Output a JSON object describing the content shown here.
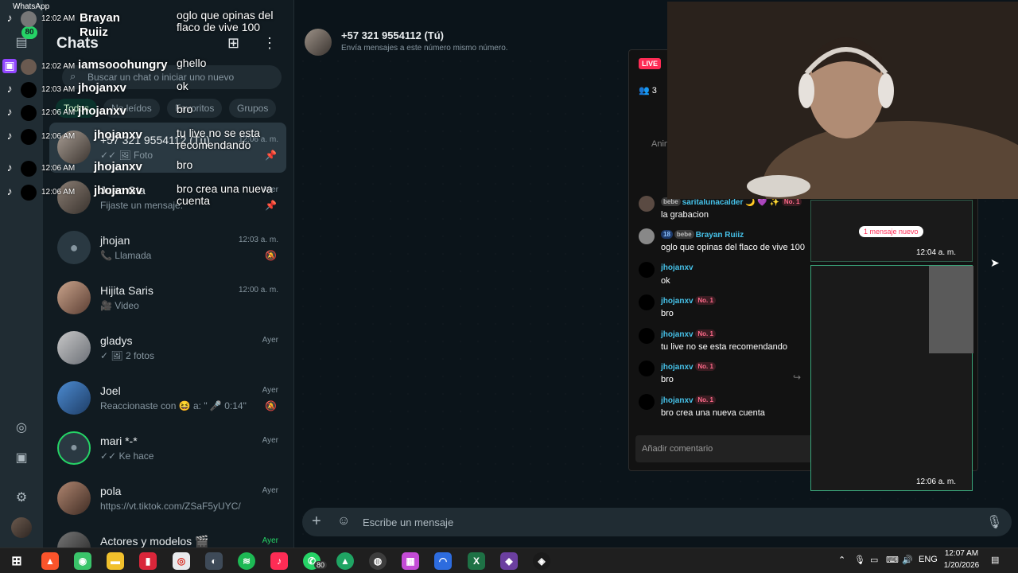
{
  "window": {
    "app_name": "WhatsApp"
  },
  "rail": {
    "badge": "80"
  },
  "panel": {
    "title": "Chats",
    "search_placeholder": "Buscar un chat o iniciar uno nuevo",
    "filters": [
      "Todos",
      "No leídos",
      "Favoritos",
      "Grupos"
    ]
  },
  "chats": [
    {
      "name": "+57 321 9554112 (Tú)",
      "time": "12:06 a. m.",
      "preview": "✓✓ 🖼 Foto"
    },
    {
      "name": "Juan Gta",
      "time": "Ayer",
      "preview": "Fijaste un mensaje."
    },
    {
      "name": "jhojan",
      "time": "12:03 a. m.",
      "preview": "📞 Llamada"
    },
    {
      "name": "Hijita Saris",
      "time": "12:00 a. m.",
      "preview": "🎥 Video"
    },
    {
      "name": "gladys",
      "time": "Ayer",
      "preview": "✓ 🖼 2 fotos"
    },
    {
      "name": "Joel",
      "time": "Ayer",
      "preview": "Reaccionaste con 😆 a: \" 🎤 0:14\""
    },
    {
      "name": "mari *-*",
      "time": "Ayer",
      "preview": "✓✓ Ke hace"
    },
    {
      "name": "pola",
      "time": "Ayer",
      "preview": "https://vt.tiktok.com/ZSaF5yUYC/"
    },
    {
      "name": "Actores y modelos 🎬",
      "time": "Ayer",
      "preview": ""
    }
  ],
  "conversation": {
    "title": "+57 321 9554112 (Tú)",
    "subtitle": "Envía mensajes a este número mismo número.",
    "composer_placeholder": "Escribe un mensaje"
  },
  "overlay_chat": [
    {
      "time": "12:02 AM",
      "user": "Brayan Ruiiz",
      "msg": "oglo que opinas del flaco de vive 100"
    },
    {
      "time": "12:02 AM",
      "user": "iamsooohungry",
      "msg": "ghello"
    },
    {
      "time": "12:03 AM",
      "user": "jhojanxv",
      "msg": "ok"
    },
    {
      "time": "12:06 AM",
      "user": "jhojanxv",
      "msg": "bro"
    },
    {
      "time": "12:06 AM",
      "user": "jhojanxv",
      "msg": "tu live no se esta recomendando"
    },
    {
      "time": "12:06 AM",
      "user": "jhojanxv",
      "msg": "bro"
    },
    {
      "time": "12:06 AM",
      "user": "jhojanxv",
      "msg": "bro crea una nueva cuenta"
    }
  ],
  "live": {
    "badge": "LIVE",
    "viewers": "3",
    "anim_label": "Anim",
    "comments": [
      {
        "user": "saritalunacalder 🌙 💜 ✨",
        "tags": [
          "bebe",
          "No. 1"
        ],
        "msg": "la grabacion"
      },
      {
        "user": "Brayan Ruiiz",
        "tags": [
          "18",
          "bebe"
        ],
        "msg": "oglo que opinas del flaco de vive 100"
      },
      {
        "user": "jhojanxv",
        "tags": [],
        "msg": "ok"
      },
      {
        "user": "jhojanxv",
        "tags": [
          "No. 1"
        ],
        "msg": "bro"
      },
      {
        "user": "jhojanxv",
        "tags": [
          "No. 1"
        ],
        "msg": "tu live no se esta recomendando"
      },
      {
        "user": "jhojanxv",
        "tags": [
          "No. 1"
        ],
        "msg": "bro"
      },
      {
        "user": "jhojanxv",
        "tags": [
          "No. 1"
        ],
        "msg": "bro crea una nueva cuenta"
      }
    ],
    "input_placeholder": "Añadir comentario",
    "new_message_pill": "1 mensaje nuevo",
    "nested_time_1": "12:04 a. m.",
    "nested_time_2": "12:06 a. m."
  },
  "taskbar": {
    "whatsapp_badge": "80",
    "lang": "ENG",
    "time": "12:07 AM",
    "date": "1/20/2026"
  },
  "colors": {
    "accent": "#25d366",
    "live": "#fe2c55",
    "bg": "#111b21"
  }
}
